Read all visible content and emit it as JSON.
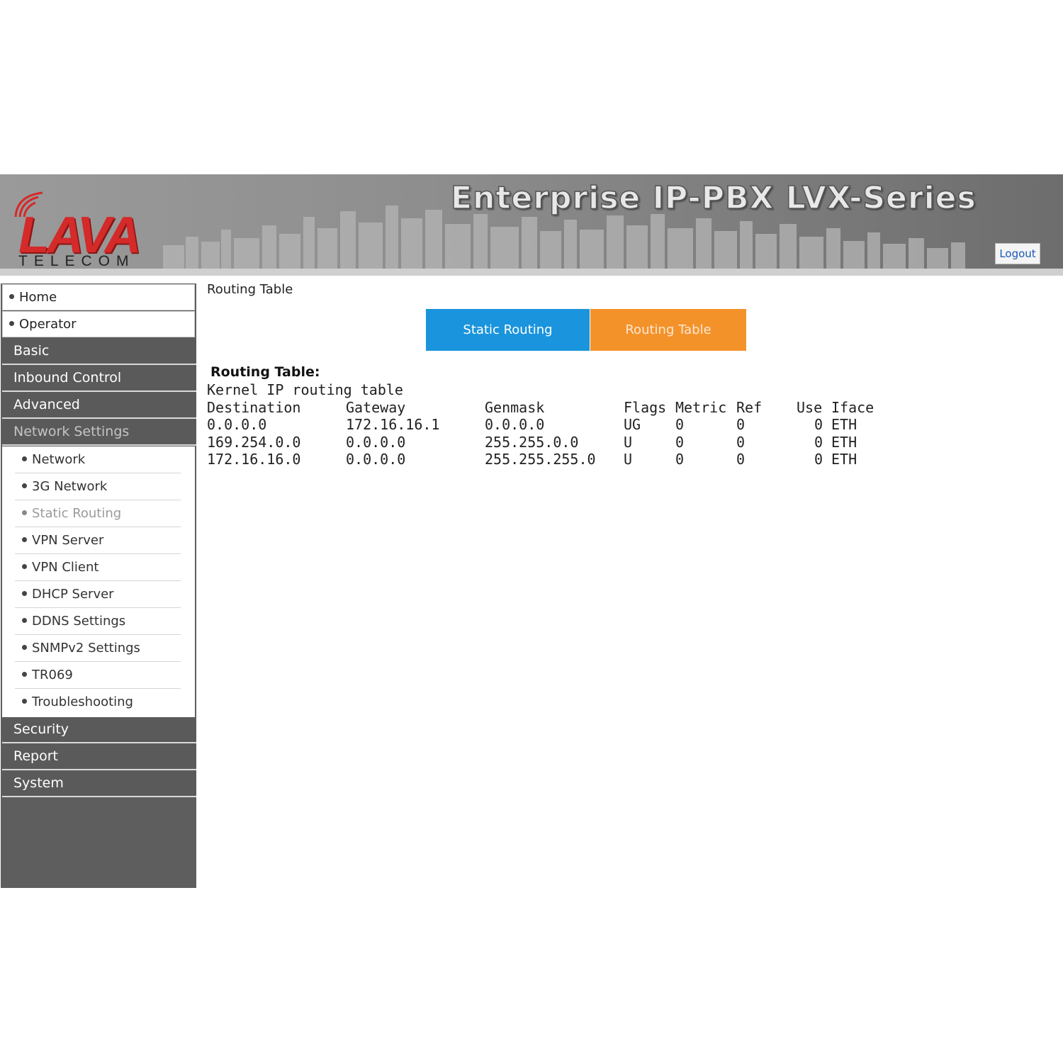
{
  "header": {
    "logo_main": "LAVA",
    "logo_sub": "TELECOM",
    "product_title": "Enterprise IP-PBX LVX-Series",
    "logout_label": "Logout"
  },
  "sidebar": {
    "top_items": [
      {
        "label": "Home"
      },
      {
        "label": "Operator"
      }
    ],
    "categories": [
      {
        "label": "Basic"
      },
      {
        "label": "Inbound Control"
      },
      {
        "label": "Advanced"
      },
      {
        "label": "Network Settings"
      }
    ],
    "network_items": [
      {
        "label": "Network"
      },
      {
        "label": "3G Network"
      },
      {
        "label": "Static Routing"
      },
      {
        "label": "VPN Server"
      },
      {
        "label": "VPN Client"
      },
      {
        "label": "DHCP Server"
      },
      {
        "label": "DDNS Settings"
      },
      {
        "label": "SNMPv2 Settings"
      },
      {
        "label": "TR069"
      },
      {
        "label": "Troubleshooting"
      }
    ],
    "bottom_categories": [
      {
        "label": "Security"
      },
      {
        "label": "Report"
      },
      {
        "label": "System"
      }
    ]
  },
  "main": {
    "page_title": "Routing Table",
    "tabs": [
      {
        "label": "Static Routing"
      },
      {
        "label": "Routing Table"
      }
    ],
    "section_heading": "Routing Table:",
    "kernel_title": "Kernel IP routing table",
    "columns": [
      "Destination",
      "Gateway",
      "Genmask",
      "Flags",
      "Metric",
      "Ref",
      "Use",
      "Iface"
    ],
    "rows": [
      [
        "0.0.0.0",
        "172.16.16.1",
        "0.0.0.0",
        "UG",
        "0",
        "0",
        "0",
        "ETH"
      ],
      [
        "169.254.0.0",
        "0.0.0.0",
        "255.255.0.0",
        "U",
        "0",
        "0",
        "0",
        "ETH"
      ],
      [
        "172.16.16.0",
        "0.0.0.0",
        "255.255.255.0",
        "U",
        "0",
        "0",
        "0",
        "ETH"
      ]
    ]
  },
  "colors": {
    "tab_static": "#1a94dc",
    "tab_routing": "#f4922a",
    "sidebar_bg": "#5e5e5e",
    "logo_red": "#d42a2a"
  }
}
